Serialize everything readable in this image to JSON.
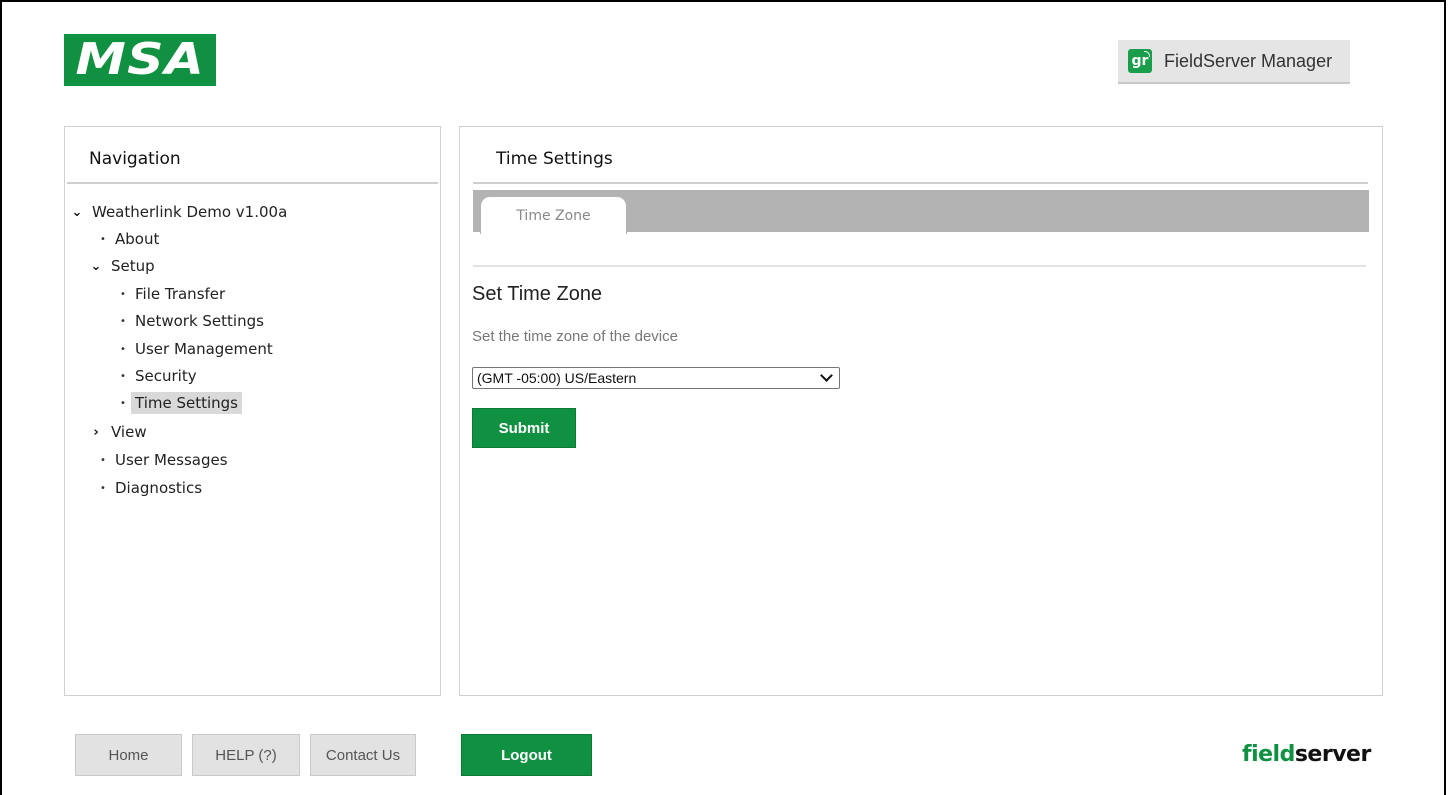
{
  "header": {
    "brand_logo_text": "MSA",
    "fieldserver_manager_label": "FieldServer Manager",
    "fieldserver_manager_icon_text": "gr"
  },
  "navigation": {
    "title": "Navigation",
    "tree": [
      {
        "label": "Weatherlink Demo v1.00a",
        "marker": "chevron-down-icon",
        "level": 0
      },
      {
        "label": "About",
        "marker": "bullet",
        "level": 1
      },
      {
        "label": "Setup",
        "marker": "chevron-down-icon",
        "level": 1
      },
      {
        "label": "File Transfer",
        "marker": "bullet",
        "level": 2
      },
      {
        "label": "Network Settings",
        "marker": "bullet",
        "level": 2
      },
      {
        "label": "User Management",
        "marker": "bullet",
        "level": 2
      },
      {
        "label": "Security",
        "marker": "bullet",
        "level": 2
      },
      {
        "label": "Time Settings",
        "marker": "bullet",
        "level": 2,
        "selected": true
      },
      {
        "label": "View",
        "marker": "chevron-right-icon",
        "level": 1
      },
      {
        "label": "User Messages",
        "marker": "bullet",
        "level": 1
      },
      {
        "label": "Diagnostics",
        "marker": "bullet",
        "level": 1
      }
    ]
  },
  "main": {
    "title": "Time Settings",
    "tabs": [
      {
        "label": "Time Zone",
        "active": true
      }
    ],
    "section_title": "Set Time Zone",
    "section_description": "Set the time zone of the device",
    "timezone_selected": "(GMT -05:00) US/Eastern",
    "submit_label": "Submit"
  },
  "footer": {
    "home_label": "Home",
    "help_label": "HELP (?)",
    "contact_label": "Contact Us",
    "logout_label": "Logout",
    "brand_part1": "field",
    "brand_part2": "server"
  },
  "colors": {
    "brand_green": "#0f9141",
    "tab_bar_gray": "#b3b3b3",
    "selected_item_bg": "#d9d9d9",
    "footer_button_bg": "#e2e2e2"
  }
}
